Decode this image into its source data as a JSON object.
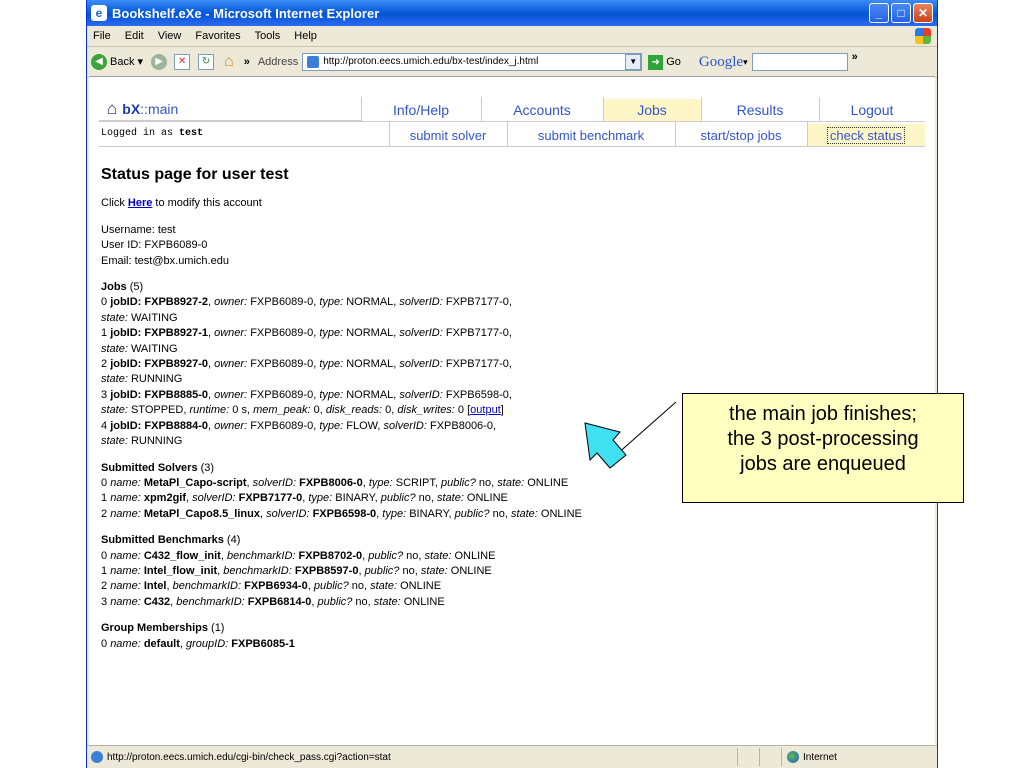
{
  "window": {
    "title": "Bookshelf.eXe - Microsoft Internet Explorer",
    "menus": [
      "File",
      "Edit",
      "View",
      "Favorites",
      "Tools",
      "Help"
    ],
    "toolbar": {
      "back_label": "Back",
      "more_label": "»",
      "address_label": "Address",
      "address_value": "http://proton.eecs.umich.edu/bx-test/index_j.html",
      "go_label": "Go",
      "google_label": "Google",
      "more_label_right": "»"
    },
    "status_url": "http://proton.eecs.umich.edu/cgi-bin/check_pass.cgi?action=stat",
    "zone_label": "Internet"
  },
  "nav": {
    "brand_prefix": "bX",
    "brand_suffix": "::main",
    "tabs": [
      "Info/Help",
      "Accounts",
      "Jobs",
      "Results",
      "Logout"
    ],
    "subtabs": [
      "submit solver",
      "submit benchmark",
      "start/stop jobs",
      "check status"
    ],
    "logged_prefix": "Logged in as",
    "logged_user": "test",
    "active_color": "#fff6c8"
  },
  "page": {
    "heading": "Status page for user test",
    "click_prefix": "Click ",
    "click_link": "Here",
    "click_suffix": " to modify this account",
    "username": "Username: test",
    "userid": "User ID: FXPB6089-0",
    "email": "Email: test@bx.umich.edu",
    "jobs_title": "Jobs",
    "jobs_count": " (5)",
    "solvers_title": "Submitted Solvers",
    "solvers_count": " (3)",
    "benchmarks_title": "Submitted Benchmarks",
    "benchmarks_count": " (4)",
    "groups_title": "Group Memberships",
    "groups_count": " (1)"
  },
  "jobs": [
    {
      "idx": "0 ",
      "id": "FXPB8927-2",
      "owner": "FXPB6089-0",
      "type": "NORMAL",
      "solver_key": "solverID:",
      "solver": "FXPB7177-0",
      "state": "WAITING"
    },
    {
      "idx": "1 ",
      "id": "FXPB8927-1",
      "owner": "FXPB6089-0",
      "type": "NORMAL",
      "solver_key": "solverID:",
      "solver": "FXPB7177-0",
      "state": "WAITING"
    },
    {
      "idx": "2 ",
      "id": "FXPB8927-0",
      "owner": "FXPB6089-0",
      "type": "NORMAL",
      "solver_key": "solverID:",
      "solver": "FXPB7177-0",
      "state": "RUNNING"
    },
    {
      "idx": "3 ",
      "id": "FXPB8885-0",
      "owner": "FXPB6089-0",
      "type": "NORMAL",
      "solver_key": "solverID:",
      "solver": "FXPB6598-0",
      "state": "STOPPED",
      "runtime": "0 s",
      "mem_peak": "0",
      "disk_reads": "0",
      "disk_writes": "0",
      "output": "output"
    },
    {
      "idx": "4 ",
      "id": "FXPB8884-0",
      "owner": "FXPB6089-0",
      "type": "FLOW",
      "solver_key": "solverID:",
      "solver": "FXPB8006-0",
      "state": "RUNNING"
    }
  ],
  "solvers": [
    {
      "idx": "0 ",
      "name": "MetaPl_Capo-script",
      "id": "FXPB8006-0",
      "type": "SCRIPT",
      "public": "no",
      "state": "ONLINE"
    },
    {
      "idx": "1 ",
      "name": "xpm2gif",
      "id": "FXPB7177-0",
      "type": "BINARY",
      "public": "no",
      "state": "ONLINE"
    },
    {
      "idx": "2 ",
      "name": "MetaPl_Capo8.5_linux",
      "id": "FXPB6598-0",
      "type": "BINARY",
      "public": "no",
      "state": "ONLINE"
    }
  ],
  "benchmarks": [
    {
      "idx": "0 ",
      "name": "C432_flow_init",
      "id": "FXPB8702-0",
      "public": "no",
      "state": "ONLINE"
    },
    {
      "idx": "1 ",
      "name": "Intel_flow_init",
      "id": "FXPB8597-0",
      "public": "no",
      "state": "ONLINE"
    },
    {
      "idx": "2 ",
      "name": "Intel",
      "id": "FXPB6934-0",
      "public": "no",
      "state": "ONLINE"
    },
    {
      "idx": "3 ",
      "name": "C432",
      "id": "FXPB6814-0",
      "public": "no",
      "state": "ONLINE"
    }
  ],
  "groups": [
    {
      "idx": "0 ",
      "name": "default",
      "id": "FXPB6085-1"
    }
  ],
  "callout": {
    "lines": [
      "the main job finishes;",
      "the 3 post-processing",
      "jobs are enqueued"
    ],
    "arrow_color": "#40e0f0"
  }
}
